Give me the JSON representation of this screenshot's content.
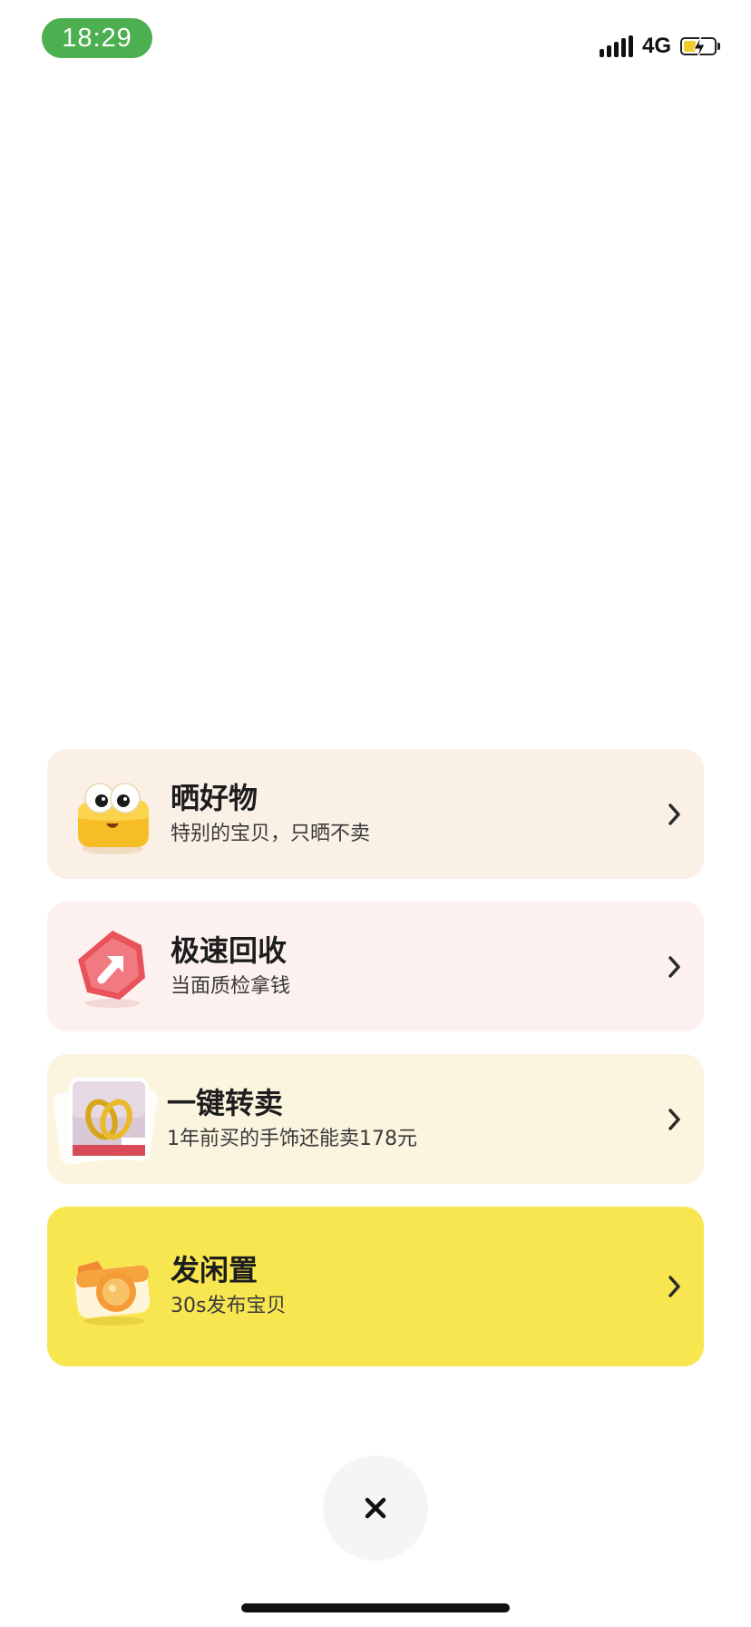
{
  "status_bar": {
    "time": "18:29",
    "network": "4G"
  },
  "menu": {
    "items": [
      {
        "title": "晒好物",
        "subtitle": "特别的宝贝，只晒不卖",
        "bg": "#faf0e6",
        "icon": "cute-box-icon"
      },
      {
        "title": "极速回收",
        "subtitle": "当面质检拿钱",
        "bg": "#fdf1f0",
        "icon": "red-arrow-badge-icon"
      },
      {
        "title": "一键转卖",
        "subtitle": "1年前买的手饰还能卖178元",
        "bg": "#fbf4de",
        "icon": "ring-photo-thumbnail"
      },
      {
        "title": "发闲置",
        "subtitle": "30s发布宝贝",
        "bg": "#f8e651",
        "icon": "camera-icon"
      }
    ]
  },
  "colors": {
    "time_pill": "#4caf50",
    "primary_yellow": "#f8e651"
  }
}
